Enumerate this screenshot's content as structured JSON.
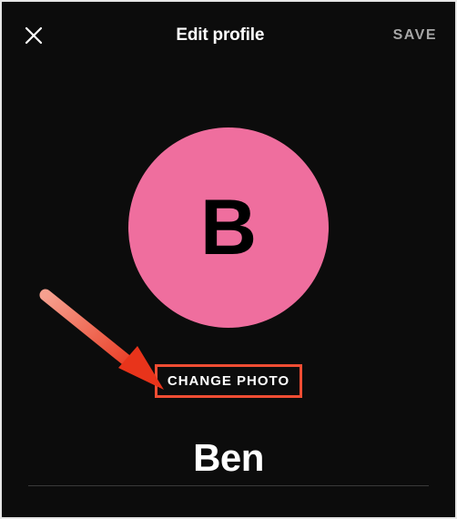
{
  "header": {
    "title": "Edit profile",
    "save_label": "SAVE"
  },
  "avatar": {
    "initial": "B",
    "bg_color": "#ef6e9e"
  },
  "change_photo_label": "CHANGE PHOTO",
  "name_value": "Ben",
  "annotation": {
    "highlight_color": "#f04d33"
  }
}
